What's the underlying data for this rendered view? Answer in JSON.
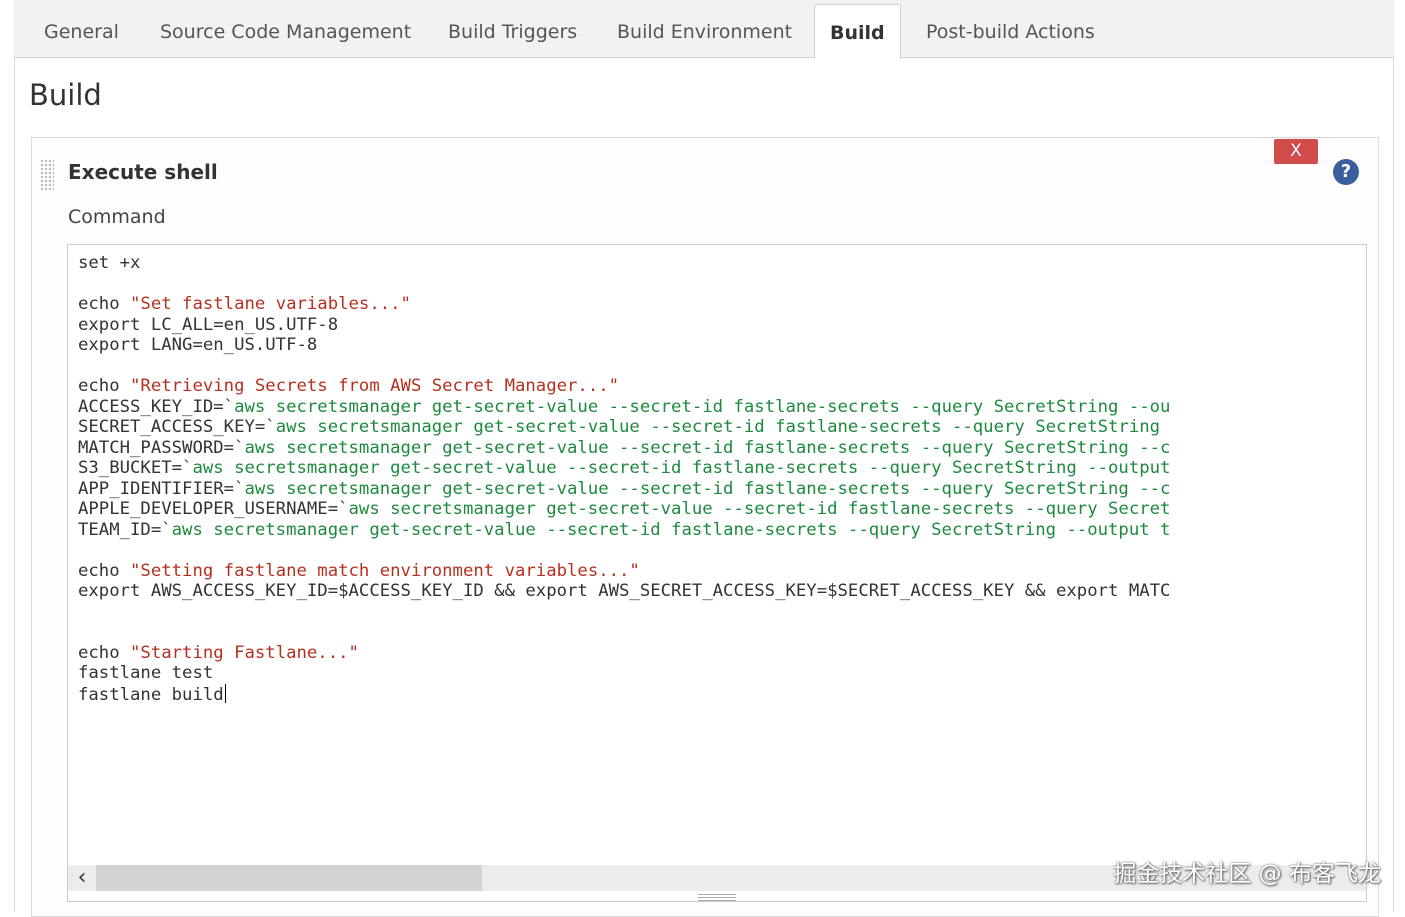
{
  "tabs": [
    {
      "label": "General",
      "active": false
    },
    {
      "label": "Source Code Management",
      "active": false
    },
    {
      "label": "Build Triggers",
      "active": false
    },
    {
      "label": "Build Environment",
      "active": false
    },
    {
      "label": "Build",
      "active": true
    },
    {
      "label": "Post-build Actions",
      "active": false
    }
  ],
  "section": {
    "title": "Build"
  },
  "step": {
    "title": "Execute shell",
    "delete_label": "X",
    "help_label": "?",
    "field_label": "Command"
  },
  "code_lines": [
    [
      {
        "t": "set +x",
        "c": "plain"
      }
    ],
    [],
    [
      {
        "t": "echo ",
        "c": "plain"
      },
      {
        "t": "\"Set fastlane variables...\"",
        "c": "str"
      }
    ],
    [
      {
        "t": "export LC_ALL=en_US.UTF-8",
        "c": "plain"
      }
    ],
    [
      {
        "t": "export LANG=en_US.UTF-8",
        "c": "plain"
      }
    ],
    [],
    [
      {
        "t": "echo ",
        "c": "plain"
      },
      {
        "t": "\"Retrieving Secrets from AWS Secret Manager...\"",
        "c": "str"
      }
    ],
    [
      {
        "t": "ACCESS_KEY_ID=`",
        "c": "plain"
      },
      {
        "t": "aws secretsmanager get-secret-value --secret-id fastlane-secrets --query SecretString --ou",
        "c": "cmd"
      }
    ],
    [
      {
        "t": "SECRET_ACCESS_KEY=`",
        "c": "plain"
      },
      {
        "t": "aws secretsmanager get-secret-value --secret-id fastlane-secrets --query SecretString",
        "c": "cmd"
      }
    ],
    [
      {
        "t": "MATCH_PASSWORD=`",
        "c": "plain"
      },
      {
        "t": "aws secretsmanager get-secret-value --secret-id fastlane-secrets --query SecretString --c",
        "c": "cmd"
      }
    ],
    [
      {
        "t": "S3_BUCKET=`",
        "c": "plain"
      },
      {
        "t": "aws secretsmanager get-secret-value --secret-id fastlane-secrets --query SecretString --output",
        "c": "cmd"
      }
    ],
    [
      {
        "t": "APP_IDENTIFIER=`",
        "c": "plain"
      },
      {
        "t": "aws secretsmanager get-secret-value --secret-id fastlane-secrets --query SecretString --c",
        "c": "cmd"
      }
    ],
    [
      {
        "t": "APPLE_DEVELOPER_USERNAME=`",
        "c": "plain"
      },
      {
        "t": "aws secretsmanager get-secret-value --secret-id fastlane-secrets --query Secret",
        "c": "cmd"
      }
    ],
    [
      {
        "t": "TEAM_ID=`",
        "c": "plain"
      },
      {
        "t": "aws secretsmanager get-secret-value --secret-id fastlane-secrets --query SecretString --output t",
        "c": "cmd"
      }
    ],
    [],
    [
      {
        "t": "echo ",
        "c": "plain"
      },
      {
        "t": "\"Setting fastlane match environment variables...\"",
        "c": "str"
      }
    ],
    [
      {
        "t": "export AWS_ACCESS_KEY_ID=$ACCESS_KEY_ID && export AWS_SECRET_ACCESS_KEY=$SECRET_ACCESS_KEY && export MATC",
        "c": "plain"
      }
    ],
    [],
    [],
    [
      {
        "t": "echo ",
        "c": "plain"
      },
      {
        "t": "\"Starting Fastlane...\"",
        "c": "str"
      }
    ],
    [
      {
        "t": "fastlane test",
        "c": "plain"
      }
    ],
    [
      {
        "t": "fastlane build",
        "c": "plain"
      }
    ]
  ],
  "editor": {
    "scroll_left_icon": "‹"
  },
  "watermark": {
    "text": "掘金技术社区 @ 布客飞龙"
  },
  "colors": {
    "string": "#b5311f",
    "command": "#1e8a3e",
    "delete": "#d24b4b",
    "help": "#3a5d9c"
  }
}
